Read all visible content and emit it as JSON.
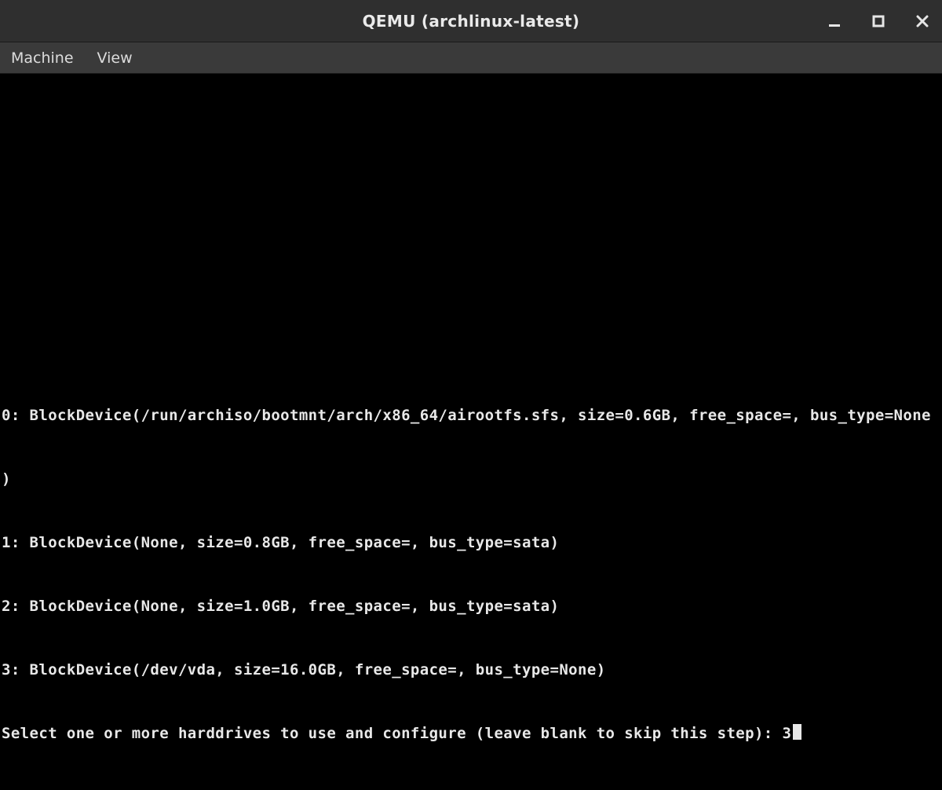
{
  "titlebar": {
    "title": "QEMU (archlinux-latest)"
  },
  "menubar": {
    "items": [
      {
        "label": "Machine"
      },
      {
        "label": "View"
      }
    ]
  },
  "terminal": {
    "lines": [
      "0: BlockDevice(/run/archiso/bootmnt/arch/x86_64/airootfs.sfs, size=0.6GB, free_space=, bus_type=None",
      ")",
      "1: BlockDevice(None, size=0.8GB, free_space=, bus_type=sata)",
      "2: BlockDevice(None, size=1.0GB, free_space=, bus_type=sata)",
      "3: BlockDevice(/dev/vda, size=16.0GB, free_space=, bus_type=None)"
    ],
    "prompt": "Select one or more harddrives to use and configure (leave blank to skip this step): ",
    "input_value": "3"
  }
}
